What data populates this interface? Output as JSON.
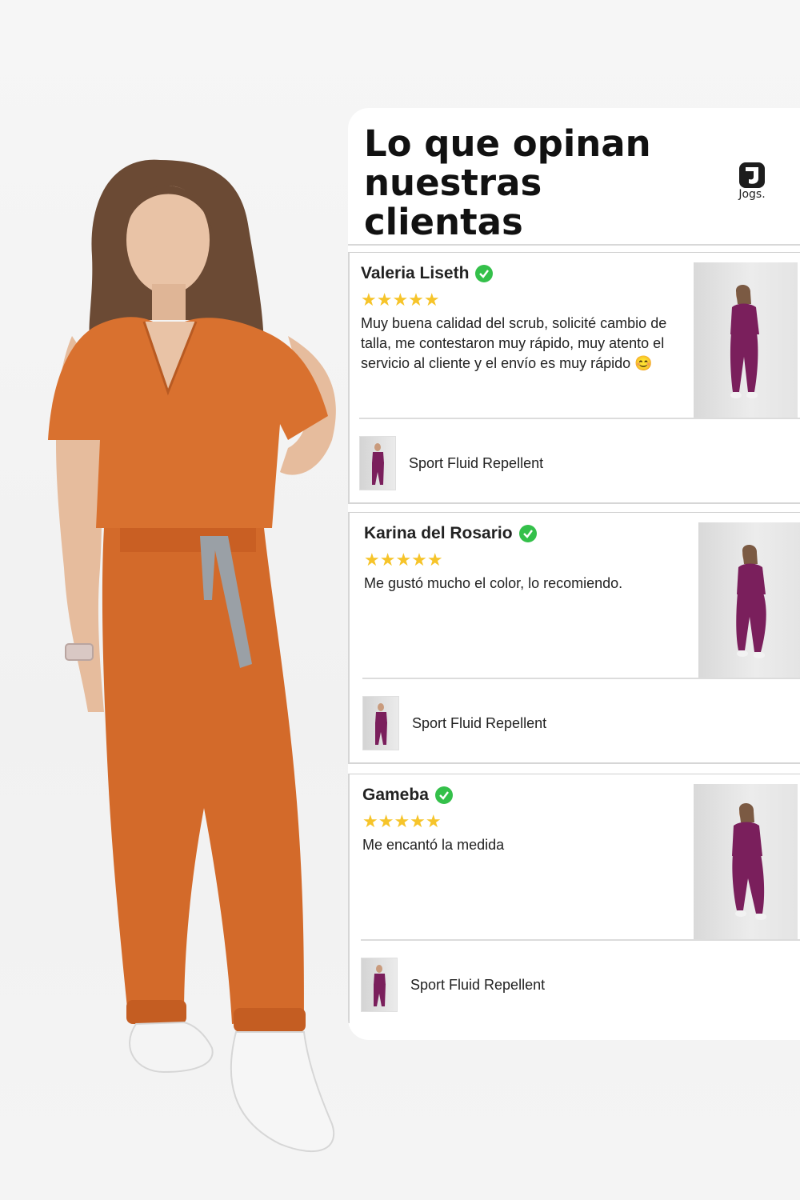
{
  "title": "Lo que opinan nuestras clientas",
  "brand": {
    "name": "Jogs.",
    "logo_icon": "jogs-logo-icon"
  },
  "colors": {
    "scrub_orange": "#d9712f",
    "product_plum": "#7a1f5c",
    "stars": "#f6c42a",
    "verified": "#34c04a"
  },
  "reviews": [
    {
      "name": "Valeria Liseth",
      "verified_icon": "check-circle-icon",
      "stars": "★★★★★",
      "rating": 5,
      "text": "Muy buena calidad del scrub, solicité cambio de talla, me contestaron muy rápido, muy atento el servicio al cliente y el envío es muy rápido 😊",
      "product": "Sport Fluid Repellent"
    },
    {
      "name": "Karina del Rosario",
      "verified_icon": "check-circle-icon",
      "stars": "★★★★★",
      "rating": 5,
      "text": "Me gustó mucho el color, lo recomiendo.",
      "product": "Sport Fluid Repellent"
    },
    {
      "name": "Gameba",
      "verified_icon": "check-circle-icon",
      "stars": "★★★★★",
      "rating": 5,
      "text": "Me encantó la medida",
      "product": "Sport Fluid Repellent"
    }
  ]
}
